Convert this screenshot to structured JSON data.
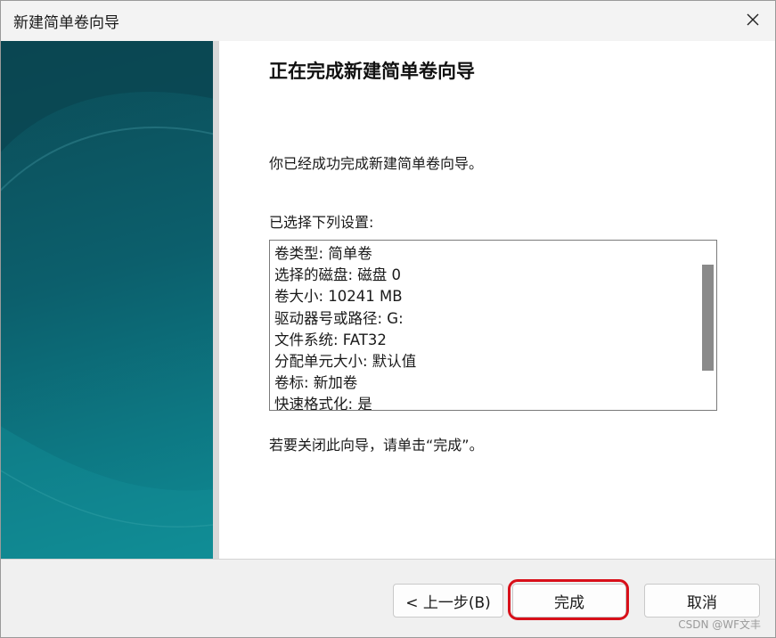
{
  "window": {
    "title": "新建简单卷向导"
  },
  "content": {
    "heading": "正在完成新建简单卷向导",
    "description": "你已经成功完成新建简单卷向导。",
    "selection_label": "已选择下列设置:",
    "summary_lines": [
      "卷类型: 简单卷",
      "选择的磁盘: 磁盘 0",
      "卷大小: 10241 MB",
      "驱动器号或路径: G:",
      "文件系统: FAT32",
      "分配单元大小: 默认值",
      "卷标: 新加卷",
      "快速格式化: 是"
    ],
    "close_hint": "若要关闭此向导，请单击“完成”。"
  },
  "buttons": {
    "back": "< 上一步(B)",
    "finish": "完成",
    "cancel": "取消"
  },
  "watermark": "CSDN @WF文丰",
  "colors": {
    "banner": "#0c5f6c",
    "highlight": "#d8101a"
  },
  "icons": {
    "close": "close-icon"
  }
}
